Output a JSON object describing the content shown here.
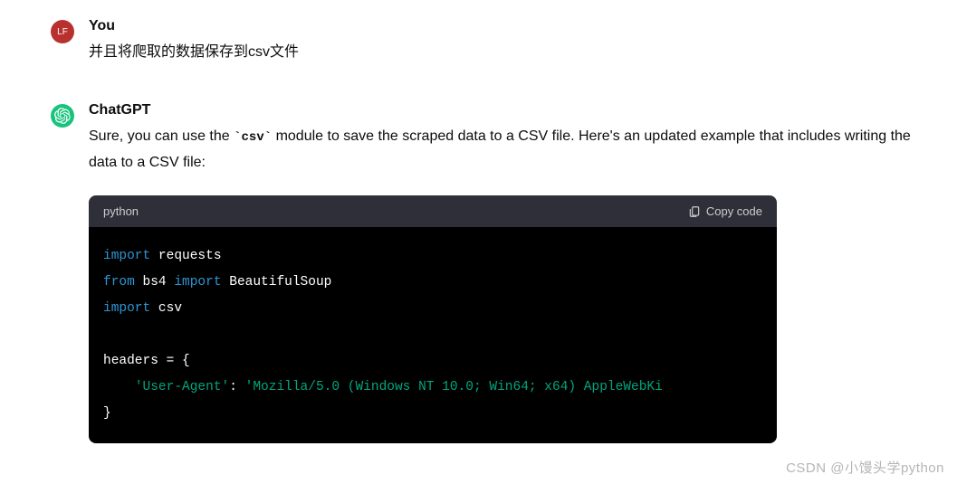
{
  "user": {
    "name": "You",
    "avatar_text": "LF",
    "message": "并且将爬取的数据保存到csv文件"
  },
  "assistant": {
    "name": "ChatGPT",
    "message_before_code": "Sure, you can use the ",
    "inline_code": "`csv`",
    "message_after_code": " module to save the scraped data to a CSV file. Here's an updated example that includes writing the data to a CSV file:"
  },
  "code": {
    "language": "python",
    "copy_label": "Copy code",
    "tokens": {
      "import1": "import",
      "requests": " requests",
      "from": "from",
      "bs4": " bs4 ",
      "import2": "import",
      "beautifulsoup": " BeautifulSoup",
      "import3": "import",
      "csv": " csv",
      "headers_line": "headers = {",
      "indent": "    ",
      "user_agent_key": "'User-Agent'",
      "colon": ": ",
      "user_agent_val": "'Mozilla/5.0 (Windows NT 10.0; Win64; x64) AppleWebKi",
      "close_brace": "}"
    }
  },
  "watermark": "CSDN @小馒头学python"
}
